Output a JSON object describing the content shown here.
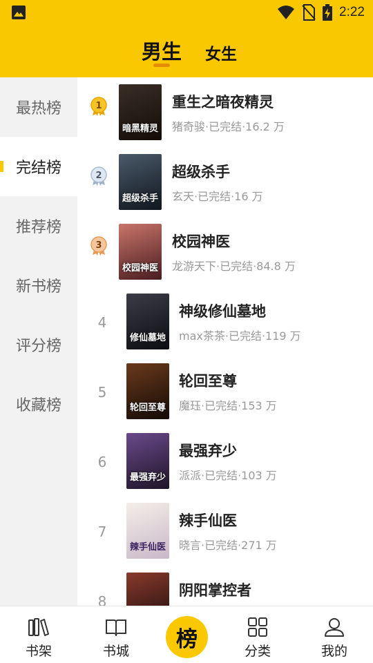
{
  "status_bar": {
    "time": "2:22"
  },
  "gender_tabs": {
    "male": "男生",
    "female": "女生"
  },
  "sidebar": {
    "items": [
      {
        "label": "最热榜"
      },
      {
        "label": "完结榜"
      },
      {
        "label": "推荐榜"
      },
      {
        "label": "新书榜"
      },
      {
        "label": "评分榜"
      },
      {
        "label": "收藏榜"
      }
    ],
    "active_index": 1
  },
  "books": [
    {
      "rank": "1",
      "title": "重生之暗夜精灵",
      "meta": "猪奇骏·已完结·16.2 万",
      "cover_text": "暗黑精灵",
      "cover_color": "#1a1410"
    },
    {
      "rank": "2",
      "title": "超级杀手",
      "meta": "玄天·已完结·16 万",
      "cover_text": "超级杀手",
      "cover_color": "#1d2530"
    },
    {
      "rank": "3",
      "title": "校园神医",
      "meta": "龙游天下·已完结·84.8 万",
      "cover_text": "校园神医",
      "cover_color": "#6a2a2a"
    },
    {
      "rank": "4",
      "title": "神级修仙墓地",
      "meta": "max茶茶·已完结·119 万",
      "cover_text": "修仙墓地",
      "cover_color": "#1e1e24"
    },
    {
      "rank": "5",
      "title": "轮回至尊",
      "meta": "魔珏·已完结·153 万",
      "cover_text": "轮回至尊",
      "cover_color": "#2a1a12"
    },
    {
      "rank": "6",
      "title": "最强弃少",
      "meta": "派派·已完结·103 万",
      "cover_text": "最强弃少",
      "cover_color": "#3a2a4a"
    },
    {
      "rank": "7",
      "title": "辣手仙医",
      "meta": "晓言·已完结·271 万",
      "cover_text": "辣手仙医",
      "cover_color": "#e9e2dc"
    },
    {
      "rank": "8",
      "title": "阴阳掌控者",
      "meta": "",
      "cover_text": "",
      "cover_color": "#2a1418"
    }
  ],
  "bottom_nav": {
    "bookshelf": "书架",
    "bookstore": "书城",
    "ranking": "榜",
    "category": "分类",
    "mine": "我的"
  },
  "colors": {
    "accent": "#f9c800",
    "indicator": "#e98b00"
  }
}
